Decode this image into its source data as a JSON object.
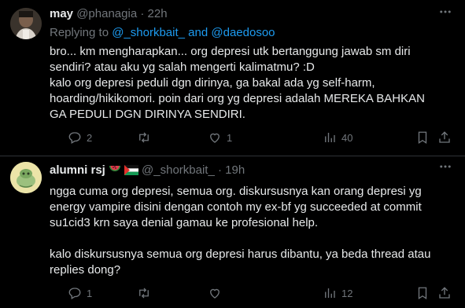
{
  "tweets": [
    {
      "name": "may",
      "handle": "@phanagia",
      "separator": "·",
      "time": "22h",
      "replying": {
        "prefix": "Replying to ",
        "user1": "@_shorkbait_",
        "connector": " and ",
        "user2": "@daedosoo"
      },
      "body": [
        "bro... km mengharapkan... org depresi utk bertanggung jawab sm diri sendiri? atau aku yg salah mengerti kalimatmu? :D\nkalo org depresi peduli dgn dirinya, ga bakal ada yg self-harm, hoarding/hikikomori. poin dari org yg depresi adalah MEREKA BAHKAN GA PEDULI DGN DIRINYA SENDIRI."
      ],
      "actions": {
        "replies": "2",
        "reposts": "",
        "likes": "1",
        "views": "40"
      }
    },
    {
      "name": "alumni rsj",
      "handle": "@_shorkbait_",
      "separator": "·",
      "time": "19h",
      "body": [
        "ngga cuma org depresi, semua org. diskursusnya kan orang depresi yg energy vampire disini dengan contoh my ex-bf yg succeeded at commit su1cid3 krn saya denial gamau ke profesional help.",
        "kalo diskursusnya semua org depresi harus dibantu, ya beda thread atau replies dong?"
      ],
      "actions": {
        "replies": "1",
        "reposts": "",
        "likes": "",
        "views": "12"
      }
    }
  ],
  "icons": [
    "more-icon",
    "reply-icon",
    "repost-icon",
    "like-icon",
    "views-icon",
    "bookmark-icon",
    "share-icon"
  ],
  "colors": {
    "background": "#000000",
    "text": "#e7e9ea",
    "muted": "#71767b",
    "accent": "#1d9bf0",
    "border": "#2f3336"
  }
}
